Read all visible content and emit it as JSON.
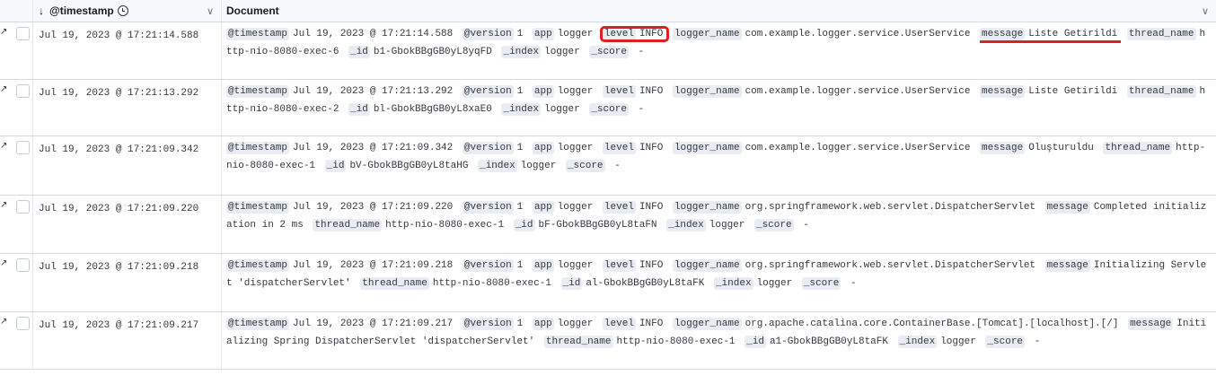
{
  "header": {
    "timestamp_label": "@timestamp",
    "document_label": "Document"
  },
  "rows": [
    {
      "timestamp": "Jul 19, 2023 @ 17:21:14.588",
      "fields": [
        {
          "k": "@timestamp",
          "v": "Jul 19, 2023 @ 17:21:14.588"
        },
        {
          "k": "@version",
          "v": "1"
        },
        {
          "k": "app",
          "v": "logger"
        },
        {
          "k": "level",
          "v": "INFO",
          "hl": "box"
        },
        {
          "k": "logger_name",
          "v": "com.example.logger.service.UserService"
        },
        {
          "k": "message",
          "v": "Liste Getirildi",
          "hl": "under"
        },
        {
          "k": "thread_name",
          "v": "http-nio-8080-exec-6"
        },
        {
          "k": "_id",
          "v": "b1-GbokBBgGB0yL8yqFD"
        },
        {
          "k": "_index",
          "v": "logger"
        },
        {
          "k": "_score",
          "v": " -"
        }
      ]
    },
    {
      "timestamp": "Jul 19, 2023 @ 17:21:13.292",
      "fields": [
        {
          "k": "@timestamp",
          "v": "Jul 19, 2023 @ 17:21:13.292"
        },
        {
          "k": "@version",
          "v": "1"
        },
        {
          "k": "app",
          "v": "logger"
        },
        {
          "k": "level",
          "v": "INFO"
        },
        {
          "k": "logger_name",
          "v": "com.example.logger.service.UserService"
        },
        {
          "k": "message",
          "v": "Liste Getirildi"
        },
        {
          "k": "thread_name",
          "v": "http-nio-8080-exec-2"
        },
        {
          "k": "_id",
          "v": "bl-GbokBBgGB0yL8xaE0"
        },
        {
          "k": "_index",
          "v": "logger"
        },
        {
          "k": "_score",
          "v": " -"
        }
      ]
    },
    {
      "timestamp": "Jul 19, 2023 @ 17:21:09.342",
      "fields": [
        {
          "k": "@timestamp",
          "v": "Jul 19, 2023 @ 17:21:09.342"
        },
        {
          "k": "@version",
          "v": "1"
        },
        {
          "k": "app",
          "v": "logger"
        },
        {
          "k": "level",
          "v": "INFO"
        },
        {
          "k": "logger_name",
          "v": "com.example.logger.service.UserService"
        },
        {
          "k": "message",
          "v": "Oluşturuldu"
        },
        {
          "k": "thread_name",
          "v": "http-nio-8080-exec-1"
        },
        {
          "k": "_id",
          "v": "bV-GbokBBgGB0yL8taHG"
        },
        {
          "k": "_index",
          "v": "logger"
        },
        {
          "k": "_score",
          "v": " -"
        }
      ]
    },
    {
      "timestamp": "Jul 19, 2023 @ 17:21:09.220",
      "fields": [
        {
          "k": "@timestamp",
          "v": "Jul 19, 2023 @ 17:21:09.220"
        },
        {
          "k": "@version",
          "v": "1"
        },
        {
          "k": "app",
          "v": "logger"
        },
        {
          "k": "level",
          "v": "INFO"
        },
        {
          "k": "logger_name",
          "v": "org.springframework.web.servlet.DispatcherServlet"
        },
        {
          "k": "message",
          "v": "Completed initialization in 2 ms"
        },
        {
          "k": "thread_name",
          "v": "http-nio-8080-exec-1"
        },
        {
          "k": "_id",
          "v": "bF-GbokBBgGB0yL8taFN"
        },
        {
          "k": "_index",
          "v": "logger"
        },
        {
          "k": "_score",
          "v": " -"
        }
      ]
    },
    {
      "timestamp": "Jul 19, 2023 @ 17:21:09.218",
      "fields": [
        {
          "k": "@timestamp",
          "v": "Jul 19, 2023 @ 17:21:09.218"
        },
        {
          "k": "@version",
          "v": "1"
        },
        {
          "k": "app",
          "v": "logger"
        },
        {
          "k": "level",
          "v": "INFO"
        },
        {
          "k": "logger_name",
          "v": "org.springframework.web.servlet.DispatcherServlet"
        },
        {
          "k": "message",
          "v": "Initializing Servlet 'dispatcherServlet'"
        },
        {
          "k": "thread_name",
          "v": "http-nio-8080-exec-1"
        },
        {
          "k": "_id",
          "v": "al-GbokBBgGB0yL8taFK"
        },
        {
          "k": "_index",
          "v": "logger"
        },
        {
          "k": "_score",
          "v": " -"
        }
      ]
    },
    {
      "timestamp": "Jul 19, 2023 @ 17:21:09.217",
      "fields": [
        {
          "k": "@timestamp",
          "v": "Jul 19, 2023 @ 17:21:09.217"
        },
        {
          "k": "@version",
          "v": "1"
        },
        {
          "k": "app",
          "v": "logger"
        },
        {
          "k": "level",
          "v": "INFO"
        },
        {
          "k": "logger_name",
          "v": "org.apache.catalina.core.ContainerBase.[Tomcat].[localhost].[/]"
        },
        {
          "k": "message",
          "v": "Initializing Spring DispatcherServlet 'dispatcherServlet'"
        },
        {
          "k": "thread_name",
          "v": "http-nio-8080-exec-1"
        },
        {
          "k": "_id",
          "v": "a1-GbokBBgGB0yL8taFK"
        },
        {
          "k": "_index",
          "v": "logger"
        },
        {
          "k": "_score",
          "v": " -"
        }
      ]
    }
  ],
  "colors": {
    "badge_bg": "#e9edf3",
    "annotation_red": "#e0201e",
    "border": "#d3dae6"
  }
}
